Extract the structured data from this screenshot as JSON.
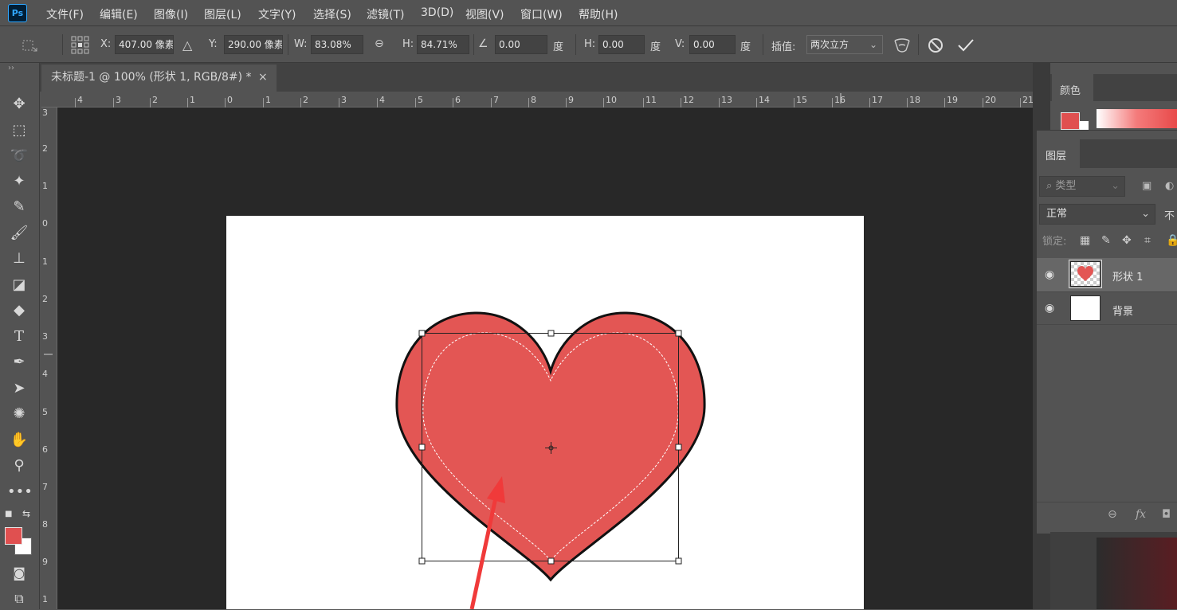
{
  "app": {
    "logo": "Ps"
  },
  "menu": [
    "文件(F)",
    "编辑(E)",
    "图像(I)",
    "图层(L)",
    "文字(Y)",
    "选择(S)",
    "滤镜(T)",
    "3D(D)",
    "视图(V)",
    "窗口(W)",
    "帮助(H)"
  ],
  "options": {
    "x_label": "X:",
    "x_value": "407.00 像素",
    "y_label": "Y:",
    "y_value": "290.00 像素",
    "w_label": "W:",
    "w_value": "83.08%",
    "h_label": "H:",
    "h_value": "84.71%",
    "rotate_value": "0.00",
    "rotate_unit": "度",
    "skew_h_label": "H:",
    "skew_h_value": "0.00",
    "skew_h_unit": "度",
    "skew_v_label": "V:",
    "skew_v_value": "0.00",
    "skew_v_unit": "度",
    "interp_label": "插值:",
    "interp_value": "两次立方"
  },
  "document": {
    "tab_title": "未标题-1 @ 100% (形状 1, RGB/8#) *",
    "close": "×"
  },
  "rulers": {
    "h_ticks": [
      "4",
      "3",
      "2",
      "1",
      "0",
      "1",
      "2",
      "3",
      "4",
      "5",
      "6",
      "7",
      "8",
      "9",
      "10",
      "11",
      "12",
      "13",
      "14",
      "15",
      "16",
      "17",
      "18",
      "19",
      "20",
      "21"
    ],
    "v_ticks": [
      "3",
      "2",
      "1",
      "0",
      "1",
      "2",
      "3",
      "4",
      "5",
      "6",
      "7",
      "8",
      "9",
      "1"
    ]
  },
  "panels": {
    "color_tab": "颜色",
    "layers_tab": "图层",
    "filter_placeholder": "类型",
    "blend_mode": "正常",
    "opacity_label": "不",
    "lock_label": "锁定:",
    "layers": [
      {
        "name": "形状 1",
        "selected": true
      },
      {
        "name": "背景",
        "selected": false
      }
    ]
  },
  "colors": {
    "heart_fill": "#e35654",
    "foreground": "#e05050",
    "background": "#ffffff",
    "arrow": "#f03a3a"
  }
}
